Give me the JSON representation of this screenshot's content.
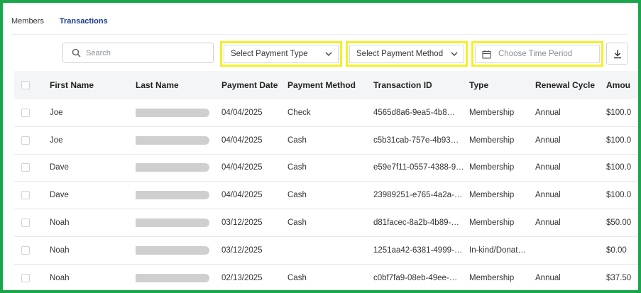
{
  "tabs": [
    {
      "label": "Members",
      "active": false
    },
    {
      "label": "Transactions",
      "active": true
    }
  ],
  "toolbar": {
    "search_placeholder": "Search",
    "payment_type_label": "Select Payment Type",
    "payment_method_label": "Select Payment Method",
    "time_period_placeholder": "Choose Time Period"
  },
  "colors": {
    "accent_tab": "#1b3a8f",
    "highlight_border": "#f3f027",
    "frame_border": "#1aa64b"
  },
  "table": {
    "columns": [
      "First Name",
      "Last Name",
      "Payment Date",
      "Payment Method",
      "Transaction ID",
      "Type",
      "Renewal Cycle",
      "Amou"
    ],
    "rows": [
      {
        "first": "Joe",
        "date": "04/04/2025",
        "method": "Check",
        "txn": "4565d8a6-9ea5-4b8…",
        "type": "Membership",
        "cycle": "Annual",
        "amount": "$100.0"
      },
      {
        "first": "Joe",
        "date": "04/04/2025",
        "method": "Cash",
        "txn": "c5b31cab-757e-4b93…",
        "type": "Membership",
        "cycle": "Annual",
        "amount": "$100.0"
      },
      {
        "first": "Dave",
        "date": "04/04/2025",
        "method": "Cash",
        "txn": "e59e7f11-0557-4388-9…",
        "type": "Membership",
        "cycle": "Annual",
        "amount": "$100.0"
      },
      {
        "first": "Dave",
        "date": "04/04/2025",
        "method": "Cash",
        "txn": "23989251-e765-4a2a-…",
        "type": "Membership",
        "cycle": "Annual",
        "amount": "$100.0"
      },
      {
        "first": "Noah",
        "date": "03/12/2025",
        "method": "Cash",
        "txn": "d81facec-8a2b-4b89-…",
        "type": "Membership",
        "cycle": "Annual",
        "amount": "$50.00"
      },
      {
        "first": "Noah",
        "date": "03/12/2025",
        "method": "",
        "txn": "1251aa42-6381-4999-…",
        "type": "In-kind/Donat…",
        "cycle": "",
        "amount": "$0.00"
      },
      {
        "first": "Noah",
        "date": "02/13/2025",
        "method": "Cash",
        "txn": "c0bf7fa9-08eb-49ee-…",
        "type": "Membership",
        "cycle": "Annual",
        "amount": "$37.50"
      }
    ]
  }
}
